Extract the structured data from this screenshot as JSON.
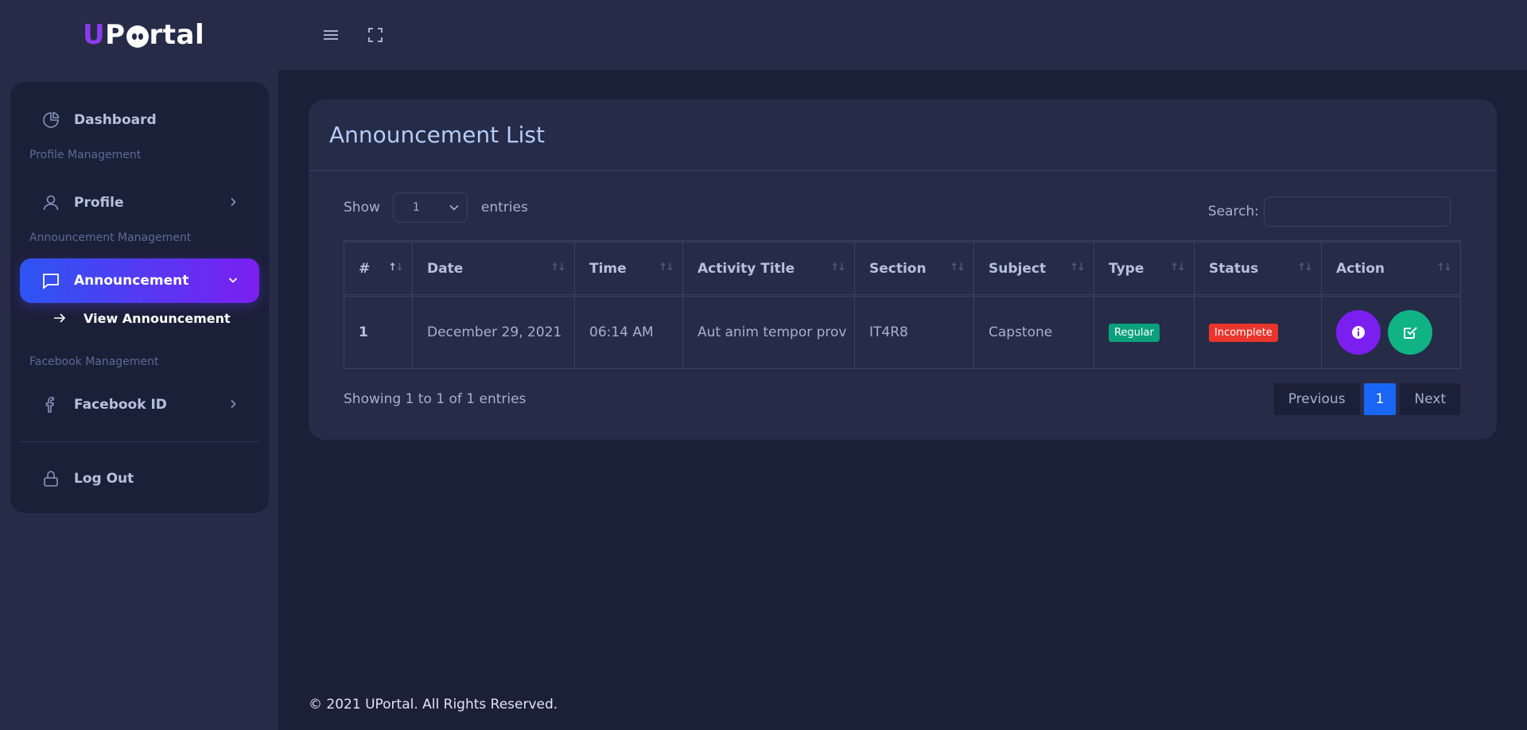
{
  "brand": {
    "logo_prefix": "U",
    "logo_suffix": "rtal"
  },
  "header": {
    "menu_icon": "hamburger-icon",
    "fullscreen_icon": "fullscreen-icon"
  },
  "sidebar": {
    "dashboard": "Dashboard",
    "profile_section": "Profile Management",
    "profile": "Profile",
    "announcement_section": "Announcement Management",
    "announcement": "Announcement",
    "view_announcement": "View Announcement",
    "facebook_section": "Facebook Management",
    "facebook": "Facebook ID",
    "logout": "Log Out",
    "active_gradient": [
      "#2d55f2",
      "#7b1ff1"
    ]
  },
  "main": {
    "title": "Announcement List",
    "show_label": "Show",
    "entries_value": "1",
    "entries_label": "entries",
    "search_label": "Search:",
    "search_value": "",
    "columns": [
      "#",
      "Date",
      "Time",
      "Activity Title",
      "Section",
      "Subject",
      "Type",
      "Status",
      "Action"
    ],
    "rows": [
      {
        "num": "1",
        "date": "December 29, 2021",
        "time": "06:14 AM",
        "activity_title": "Aut anim tempor prov",
        "section": "IT4R8",
        "subject": "Capstone",
        "type": "Regular",
        "status": "Incomplete"
      }
    ],
    "info": "Showing 1 to 1 of 1 entries",
    "pagination": {
      "previous": "Previous",
      "current": "1",
      "next": "Next"
    }
  },
  "colors": {
    "regular": "#0aa07c",
    "incomplete": "#e9352c",
    "info_button": "#7b1ff1",
    "check_button": "#10b384",
    "page_active": "#1966f5"
  },
  "footer": "© 2021 UPortal. All Rights Reserved."
}
